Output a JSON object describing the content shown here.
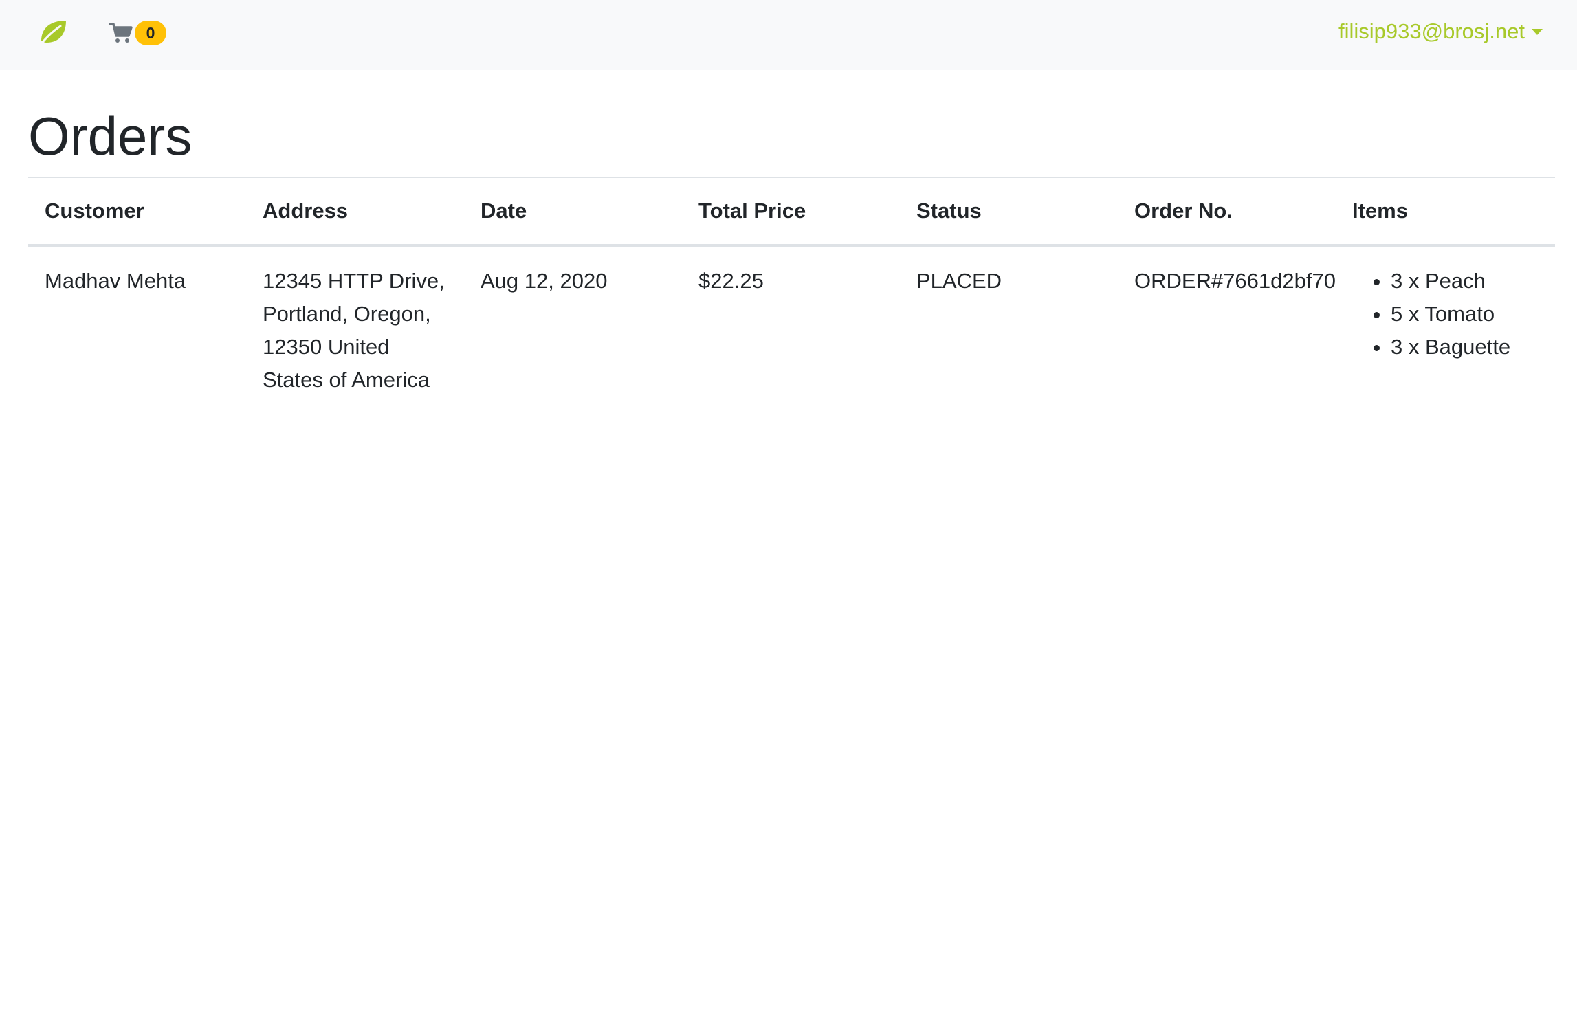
{
  "navbar": {
    "brand_icon": "leaf-icon",
    "cart_icon": "cart-icon",
    "cart_count": "0",
    "user_email": "filisip933@brosj.net",
    "accent_color": "#a8c92a",
    "badge_color": "#ffc107"
  },
  "page": {
    "title": "Orders"
  },
  "table": {
    "headers": [
      "Customer",
      "Address",
      "Date",
      "Total Price",
      "Status",
      "Order No.",
      "Items"
    ],
    "rows": [
      {
        "customer": "Madhav Mehta",
        "address": "12345 HTTP Drive, Portland, Oregon, 12350 United States of America",
        "date": "Aug 12, 2020",
        "total_price": "$22.25",
        "status": "PLACED",
        "order_no": "ORDER#7661d2bf70",
        "items": [
          "3 x Peach",
          "5 x Tomato",
          "3 x Baguette"
        ]
      }
    ]
  }
}
